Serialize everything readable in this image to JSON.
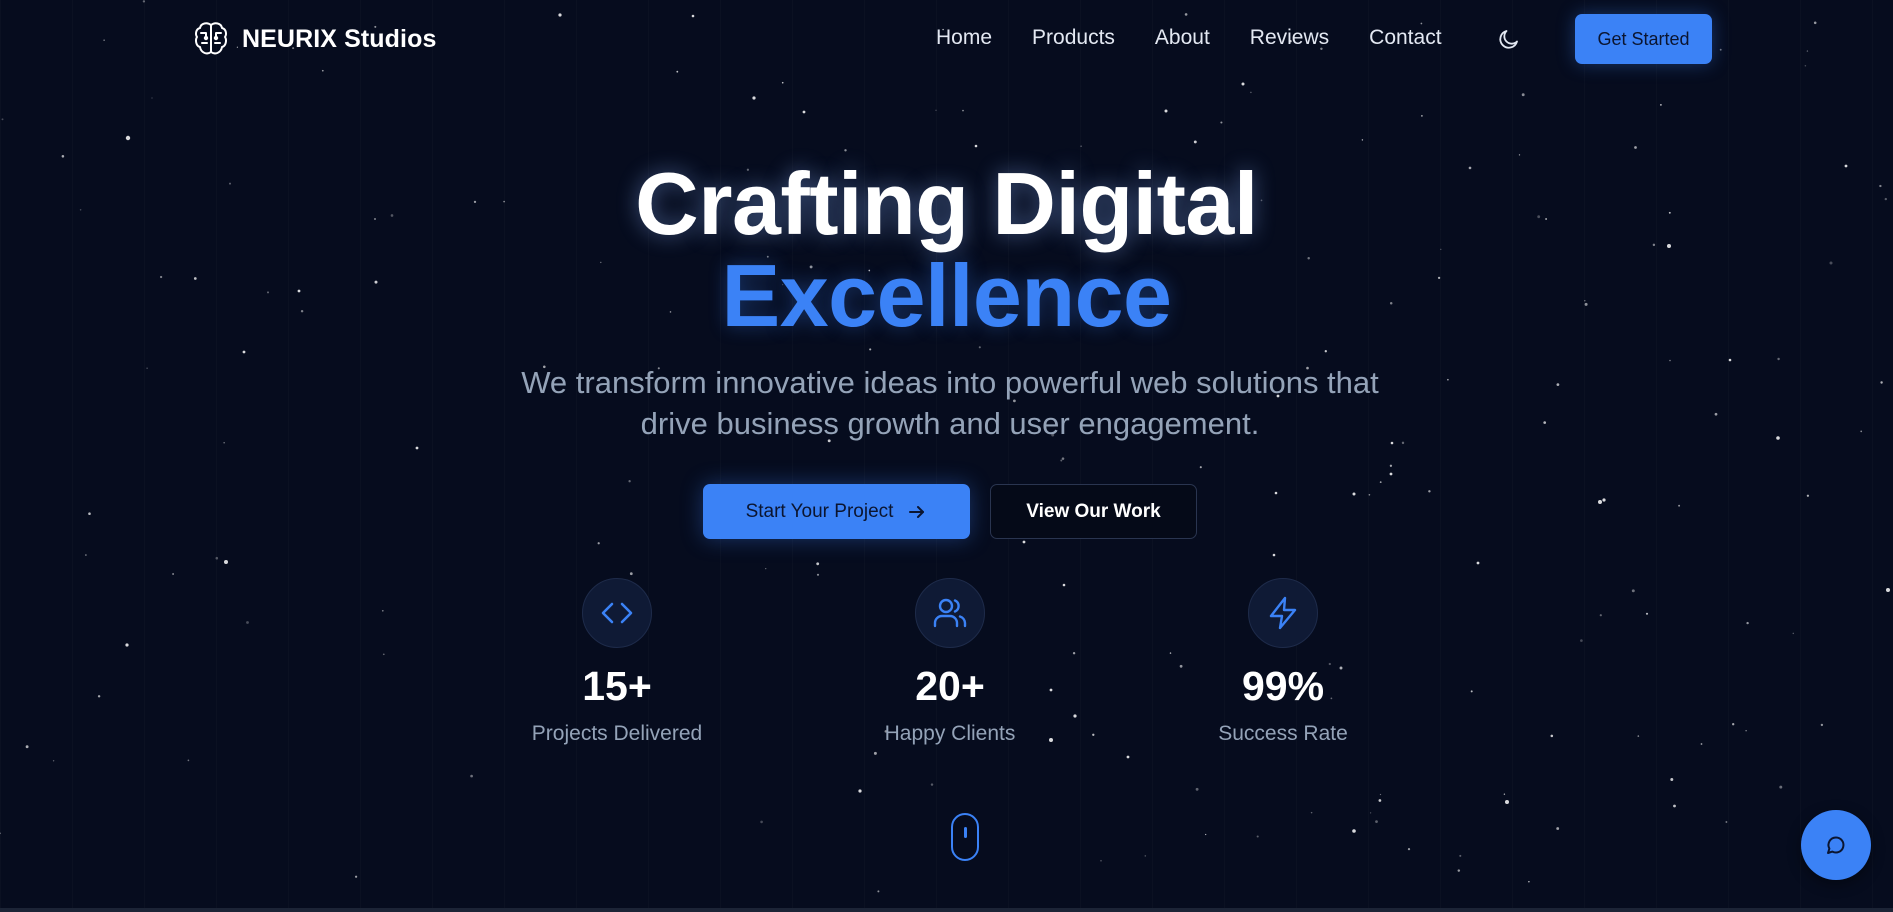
{
  "colors": {
    "background": "#060c1e",
    "accent": "#3b82f6",
    "text_primary": "#ffffff",
    "text_muted": "#94a3b8"
  },
  "header": {
    "brand_name": "NEURIX Studios",
    "brand_icon": "brain-icon",
    "nav": [
      {
        "label": "Home"
      },
      {
        "label": "Products"
      },
      {
        "label": "About"
      },
      {
        "label": "Reviews"
      },
      {
        "label": "Contact"
      }
    ],
    "theme_toggle_icon": "moon-icon",
    "cta_label": "Get Started"
  },
  "hero": {
    "title_line1": "Crafting Digital",
    "title_line2": "Excellence",
    "subtitle": "We transform innovative ideas into powerful web solutions that drive business growth and user engagement.",
    "primary_button": {
      "label": "Start Your Project",
      "icon": "arrow-right-icon"
    },
    "secondary_button": {
      "label": "View Our Work"
    }
  },
  "stats": [
    {
      "icon": "code-icon",
      "value": "15+",
      "label": "Projects Delivered"
    },
    {
      "icon": "users-icon",
      "value": "20+",
      "label": "Happy Clients"
    },
    {
      "icon": "zap-icon",
      "value": "99%",
      "label": "Success Rate"
    }
  ],
  "scroll_indicator_icon": "mouse-icon",
  "chat_icon": "chat-bubble-icon"
}
